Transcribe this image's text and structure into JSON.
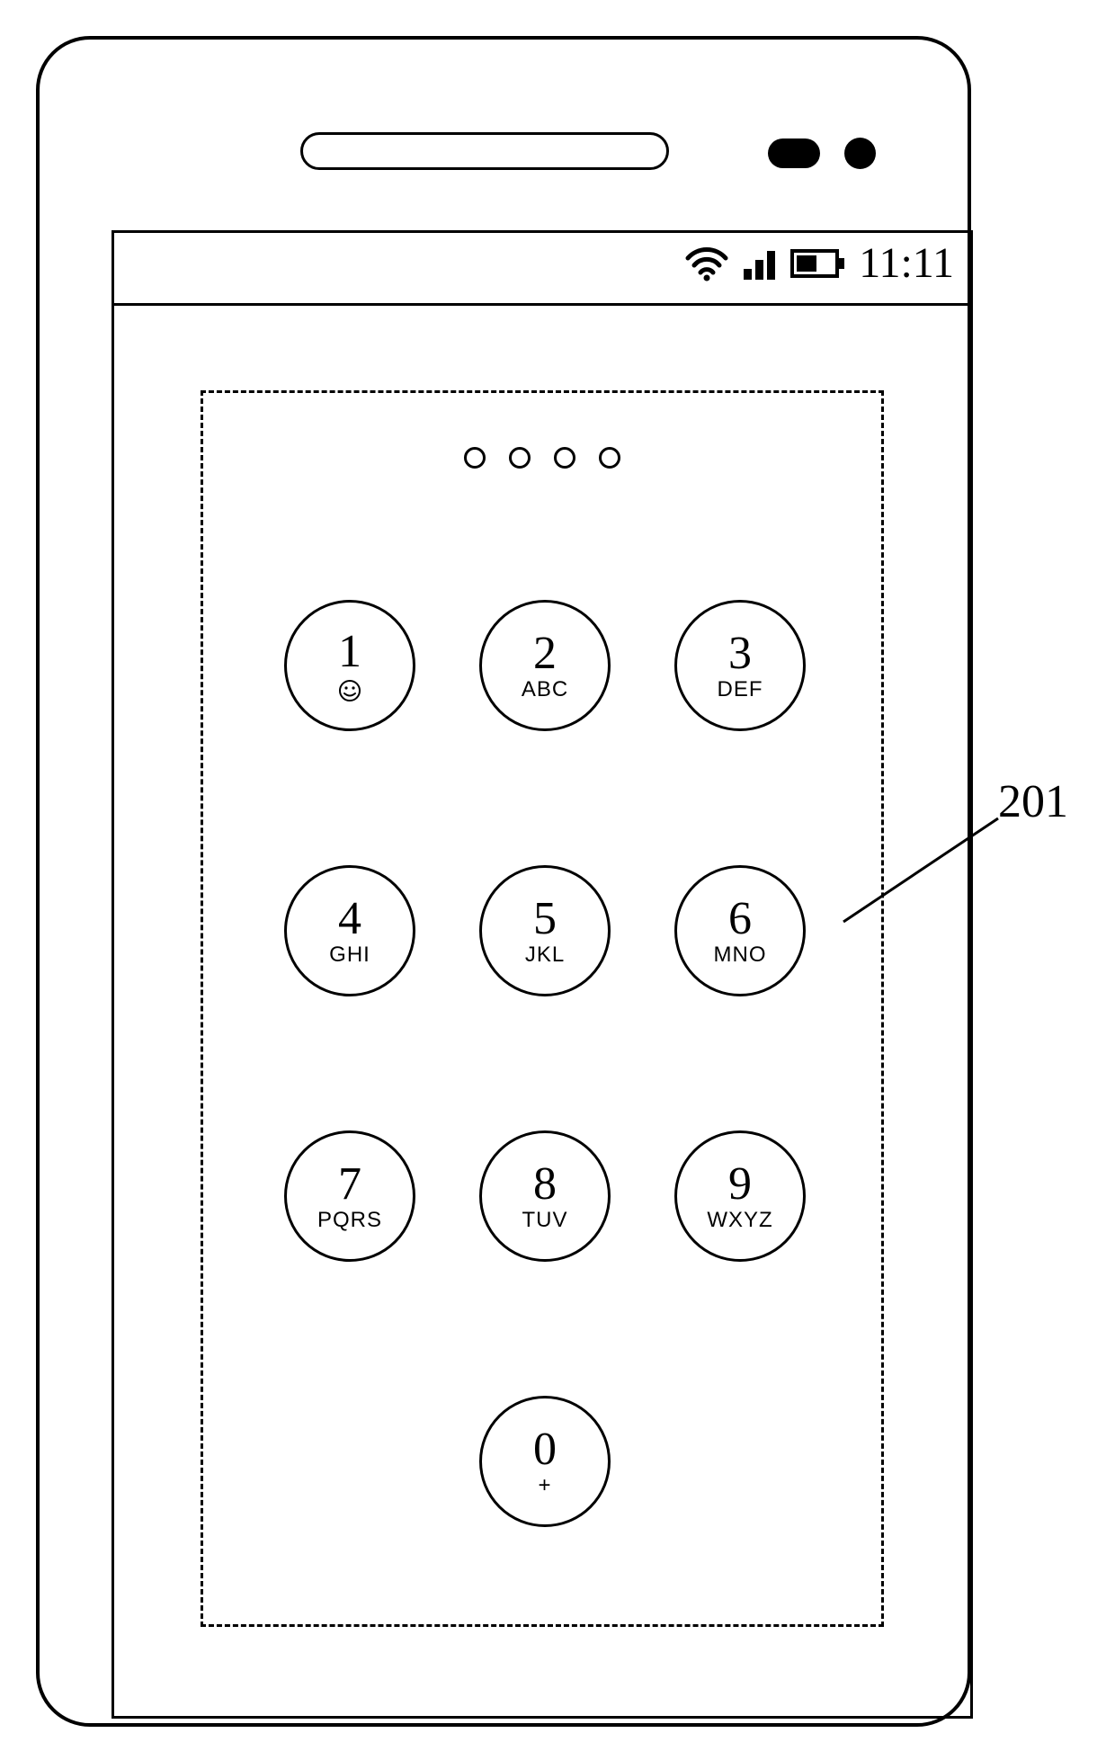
{
  "status_bar": {
    "time": "11:11"
  },
  "pin_slots": 4,
  "keypad": {
    "rows": [
      [
        {
          "num": "1",
          "letters": "",
          "smiley": true
        },
        {
          "num": "2",
          "letters": "ABC",
          "smiley": false
        },
        {
          "num": "3",
          "letters": "DEF",
          "smiley": false
        }
      ],
      [
        {
          "num": "4",
          "letters": "GHI",
          "smiley": false
        },
        {
          "num": "5",
          "letters": "JKL",
          "smiley": false
        },
        {
          "num": "6",
          "letters": "MNO",
          "smiley": false
        }
      ],
      [
        {
          "num": "7",
          "letters": "PQRS",
          "smiley": false
        },
        {
          "num": "8",
          "letters": "TUV",
          "smiley": false
        },
        {
          "num": "9",
          "letters": "WXYZ",
          "smiley": false
        }
      ],
      [
        {
          "num": "0",
          "letters": "+",
          "smiley": false
        }
      ]
    ]
  },
  "callout": {
    "label": "201"
  }
}
